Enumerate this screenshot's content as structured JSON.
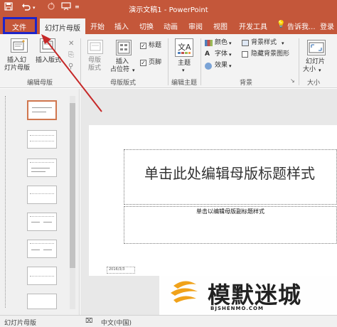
{
  "titlebar": {
    "title": "演示文稿1 - PowerPoint",
    "save_icon": "save-icon",
    "undo_icon": "undo-icon",
    "redo_icon": "redo-icon",
    "present_icon": "present-icon",
    "customize_icon": "customize-icon"
  },
  "tabs": {
    "file": "文件",
    "slide_master": "幻灯片母版",
    "home": "开始",
    "insert": "插入",
    "transitions": "切换",
    "animations": "动画",
    "review": "审阅",
    "view": "视图",
    "developer": "开发工具",
    "tell_me": "告诉我...",
    "signin": "登录"
  },
  "ribbon": {
    "insert_slide_master_line1": "插入幻",
    "insert_slide_master_line2": "灯片母版",
    "insert_layout": "插入版式",
    "edit_master_group": "编辑母版",
    "master_layout_line1": "母版",
    "master_layout_line2": "版式",
    "insert_placeholder_line1": "插入",
    "insert_placeholder_line2": "占位符",
    "title_checkbox": "标题",
    "footer_checkbox": "页脚",
    "master_layout_group": "母版版式",
    "theme": "主题",
    "edit_theme_group": "编辑主题",
    "colors": "颜色",
    "fonts": "字体",
    "effects": "效果",
    "background_styles": "背景样式",
    "hide_background_graphics": "隐藏背景图形",
    "background_group": "背景",
    "slide_size_line1": "幻灯片",
    "slide_size_line2": "大小",
    "size_group": "大小",
    "title_checked": true,
    "footer_checked": true,
    "hide_bg_checked": false
  },
  "slide": {
    "title_placeholder": "单击此处编辑母版标题样式",
    "subtitle_placeholder": "单击以编辑母版副标题样式",
    "date_text": "2016/3/3"
  },
  "watermark": {
    "text": "模默迷城",
    "url": "BJSHENMO.COM"
  },
  "statusbar": {
    "view_name": "幻灯片母版",
    "language": "中文(中国)"
  },
  "colors": {
    "accent": "#c4573a",
    "highlight_box": "#1e24c9",
    "annotation_arrow": "#c62828"
  }
}
